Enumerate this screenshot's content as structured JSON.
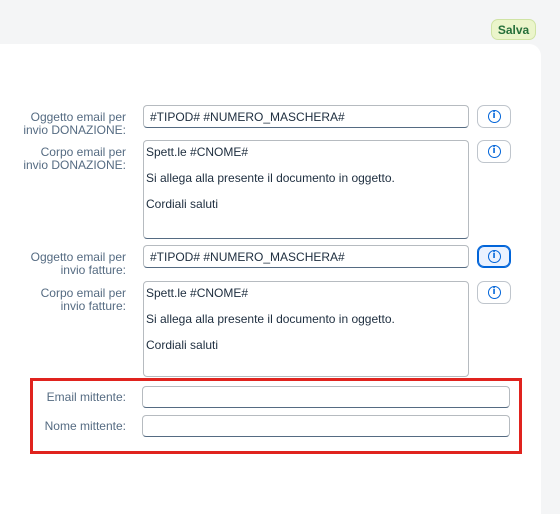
{
  "toolbar": {
    "save_label": "Salva"
  },
  "form": {
    "subject_donation": {
      "label_line1": "Oggetto email per",
      "label_line2": "invio DONAZIONE:",
      "value": "#TIPOD# #NUMERO_MASCHERA#"
    },
    "body_donation": {
      "label_line1": "Corpo email per",
      "label_line2": "invio DONAZIONE:",
      "lines": [
        "Spett.le #CNOME#",
        "Si allega alla presente il documento in oggetto.",
        "Cordiali saluti"
      ]
    },
    "subject_invoice": {
      "label_line1": "Oggetto email per",
      "label_line2": "invio fatture:",
      "value": "#TIPOD# #NUMERO_MASCHERA#"
    },
    "body_invoice": {
      "label_line1": "Corpo email per",
      "label_line2": "invio fatture:",
      "lines": [
        "Spett.le #CNOME#",
        "Si allega alla presente il documento in oggetto.",
        "Cordiali saluti"
      ]
    },
    "sender_email": {
      "label": "Email mittente:",
      "value": ""
    },
    "sender_name": {
      "label": "Nome mittente:",
      "value": ""
    }
  },
  "icons": {
    "info": "info-icon",
    "info_glyph": "i"
  },
  "colors": {
    "accent": "#0064d9",
    "highlight": "#e0231e",
    "label": "#556b82"
  }
}
